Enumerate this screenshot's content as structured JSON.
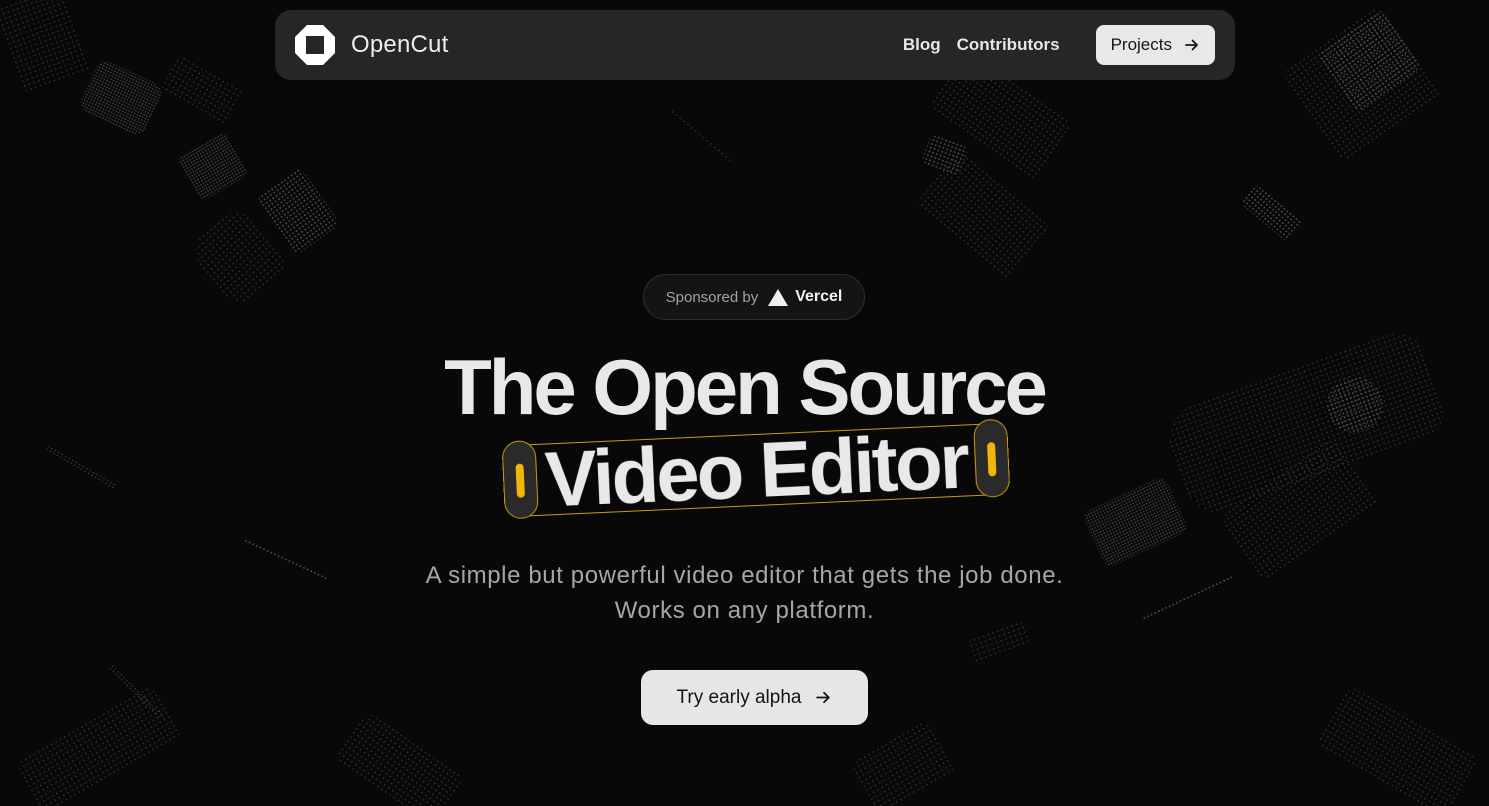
{
  "nav": {
    "brand": "OpenCut",
    "links": [
      {
        "label": "Blog"
      },
      {
        "label": "Contributors"
      }
    ],
    "projects_label": "Projects"
  },
  "sponsor": {
    "prefix": "Sponsored by",
    "name": "Vercel"
  },
  "hero": {
    "title_line1": "The Open Source",
    "title_line2": "Video Editor",
    "subtitle_line1": "A simple but powerful video editor that gets the job done.",
    "subtitle_line2": "Works on any platform.",
    "cta_label": "Try early alpha"
  },
  "colors": {
    "background": "#080808",
    "navbar": "#262626",
    "accent": "#f0b60a",
    "button": "#e6e6e6"
  },
  "icons": {
    "logo": "opencut-logo-icon",
    "vercel": "vercel-triangle-icon",
    "arrow": "arrow-right-icon"
  }
}
